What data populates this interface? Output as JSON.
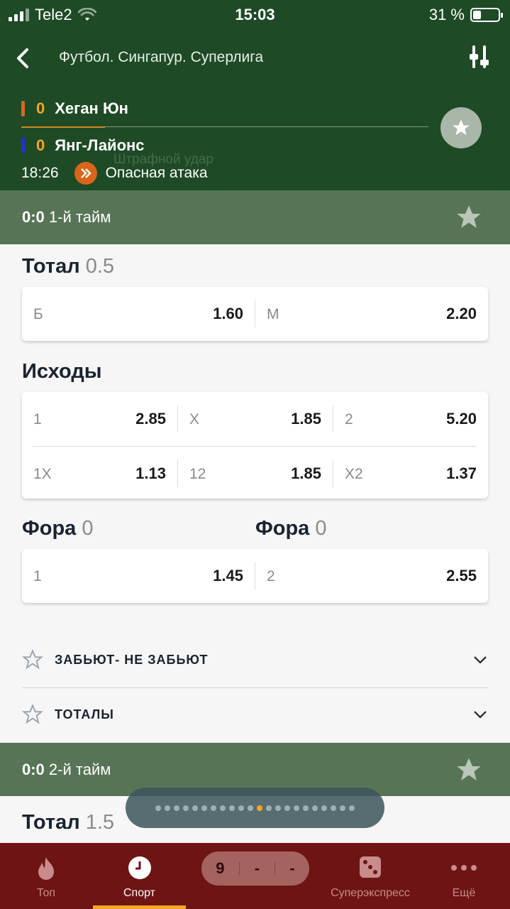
{
  "status": {
    "carrier": "Tele2",
    "time": "15:03",
    "battery": "31 %",
    "battery_level": 0.31
  },
  "header": {
    "title": "Футбол. Сингапур. Суперлига"
  },
  "match": {
    "team1": {
      "score": "0",
      "name": "Хеган Юн",
      "color": "#d2691e"
    },
    "team2": {
      "score": "0",
      "name": "Янг-Лайонс",
      "color": "#2233cc"
    },
    "time": "18:26",
    "event": "Опасная атака",
    "ghost_event": "Штрафной удар"
  },
  "period1": {
    "score": "0:0",
    "label": "1-й тайм"
  },
  "total": {
    "title": "Тотал",
    "value": "0.5",
    "over_label": "Б",
    "over_odds": "1.60",
    "under_label": "М",
    "under_odds": "2.20"
  },
  "outcomes": {
    "title": "Исходы",
    "row1": [
      {
        "k": "1",
        "v": "2.85"
      },
      {
        "k": "X",
        "v": "1.85"
      },
      {
        "k": "2",
        "v": "5.20"
      }
    ],
    "row2": [
      {
        "k": "1X",
        "v": "1.13"
      },
      {
        "k": "12",
        "v": "1.85"
      },
      {
        "k": "X2",
        "v": "1.37"
      }
    ]
  },
  "handicap": {
    "title1": "Фора",
    "value1": "0",
    "title2": "Фора",
    "value2": "0",
    "left": {
      "k": "1",
      "v": "1.45"
    },
    "right": {
      "k": "2",
      "v": "2.55"
    }
  },
  "accordions": [
    {
      "label": "ЗАБЬЮТ- НЕ ЗАБЬЮТ"
    },
    {
      "label": "ТОТАЛЫ"
    }
  ],
  "period2": {
    "score": "0:0",
    "label": "2-й тайм"
  },
  "total2": {
    "title": "Тотал",
    "value": "1.5"
  },
  "coupon": {
    "c1": "9",
    "c2": "-",
    "c3": "-"
  },
  "tabs": [
    {
      "label": "Топ"
    },
    {
      "label": "Спорт"
    },
    {
      "label": "Суперэкспресс"
    },
    {
      "label": "Ещё"
    }
  ],
  "colors": {
    "header": "#1e4a26",
    "period": "#577556",
    "tabbar": "#6e1414",
    "accent": "#f5a623"
  }
}
